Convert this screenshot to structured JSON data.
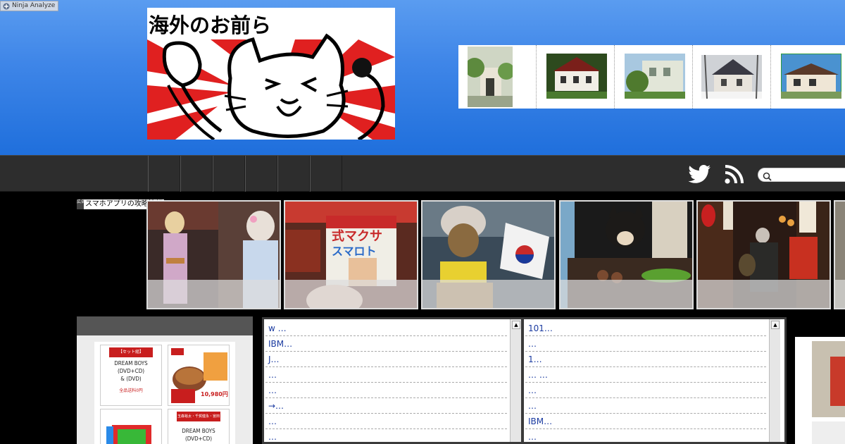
{
  "toolbar": {
    "ninja_label": "Ninja Analyze"
  },
  "header": {
    "logo_text": "海外のお前ら"
  },
  "thumbs": [
    {
      "name": "house-photo-1",
      "color": "#6b8a5a"
    },
    {
      "name": "house-photo-2",
      "color": "#7a3b2e"
    },
    {
      "name": "house-photo-3",
      "color": "#8aa876"
    },
    {
      "name": "house-photo-4",
      "color": "#8a7a6a"
    },
    {
      "name": "house-photo-5",
      "color": "#8b5a3a"
    }
  ],
  "search": {
    "placeholder": ""
  },
  "ad": {
    "label": "スマホアプリの攻略情報"
  },
  "slides": [
    {
      "name": "slide-kimono"
    },
    {
      "name": "slide-candy"
    },
    {
      "name": "slide-statue"
    },
    {
      "name": "slide-dog"
    },
    {
      "name": "slide-alley"
    }
  ],
  "products": [
    {
      "badge": "【セット組】",
      "line1": "DREAM BOYS",
      "line2": "(DVD+CD)",
      "line3": "& (DVD)",
      "foot": "全品送料0円"
    },
    {
      "badge": "牛丼",
      "price": "10,980円"
    },
    {
      "badge": "switch",
      "line1": ""
    },
    {
      "badge": "玉森裕太・千賀健永・宮田俊哉",
      "line1": "DREAM BOYS",
      "line2": "(DVD+CD)"
    }
  ],
  "rss_left": [
    "w …",
    "IBM…",
    "J…",
    " …",
    "…",
    "→…",
    " …",
    " …"
  ],
  "rss_right": [
    "101…",
    " …",
    " 1…",
    "… …",
    " …",
    "…",
    "IBM…",
    "…"
  ],
  "colors": {
    "header_top": "#5a9cf0",
    "header_bottom": "#1f6fdc",
    "nav_bg": "#2d2d2d",
    "link": "#1a3aa0"
  }
}
